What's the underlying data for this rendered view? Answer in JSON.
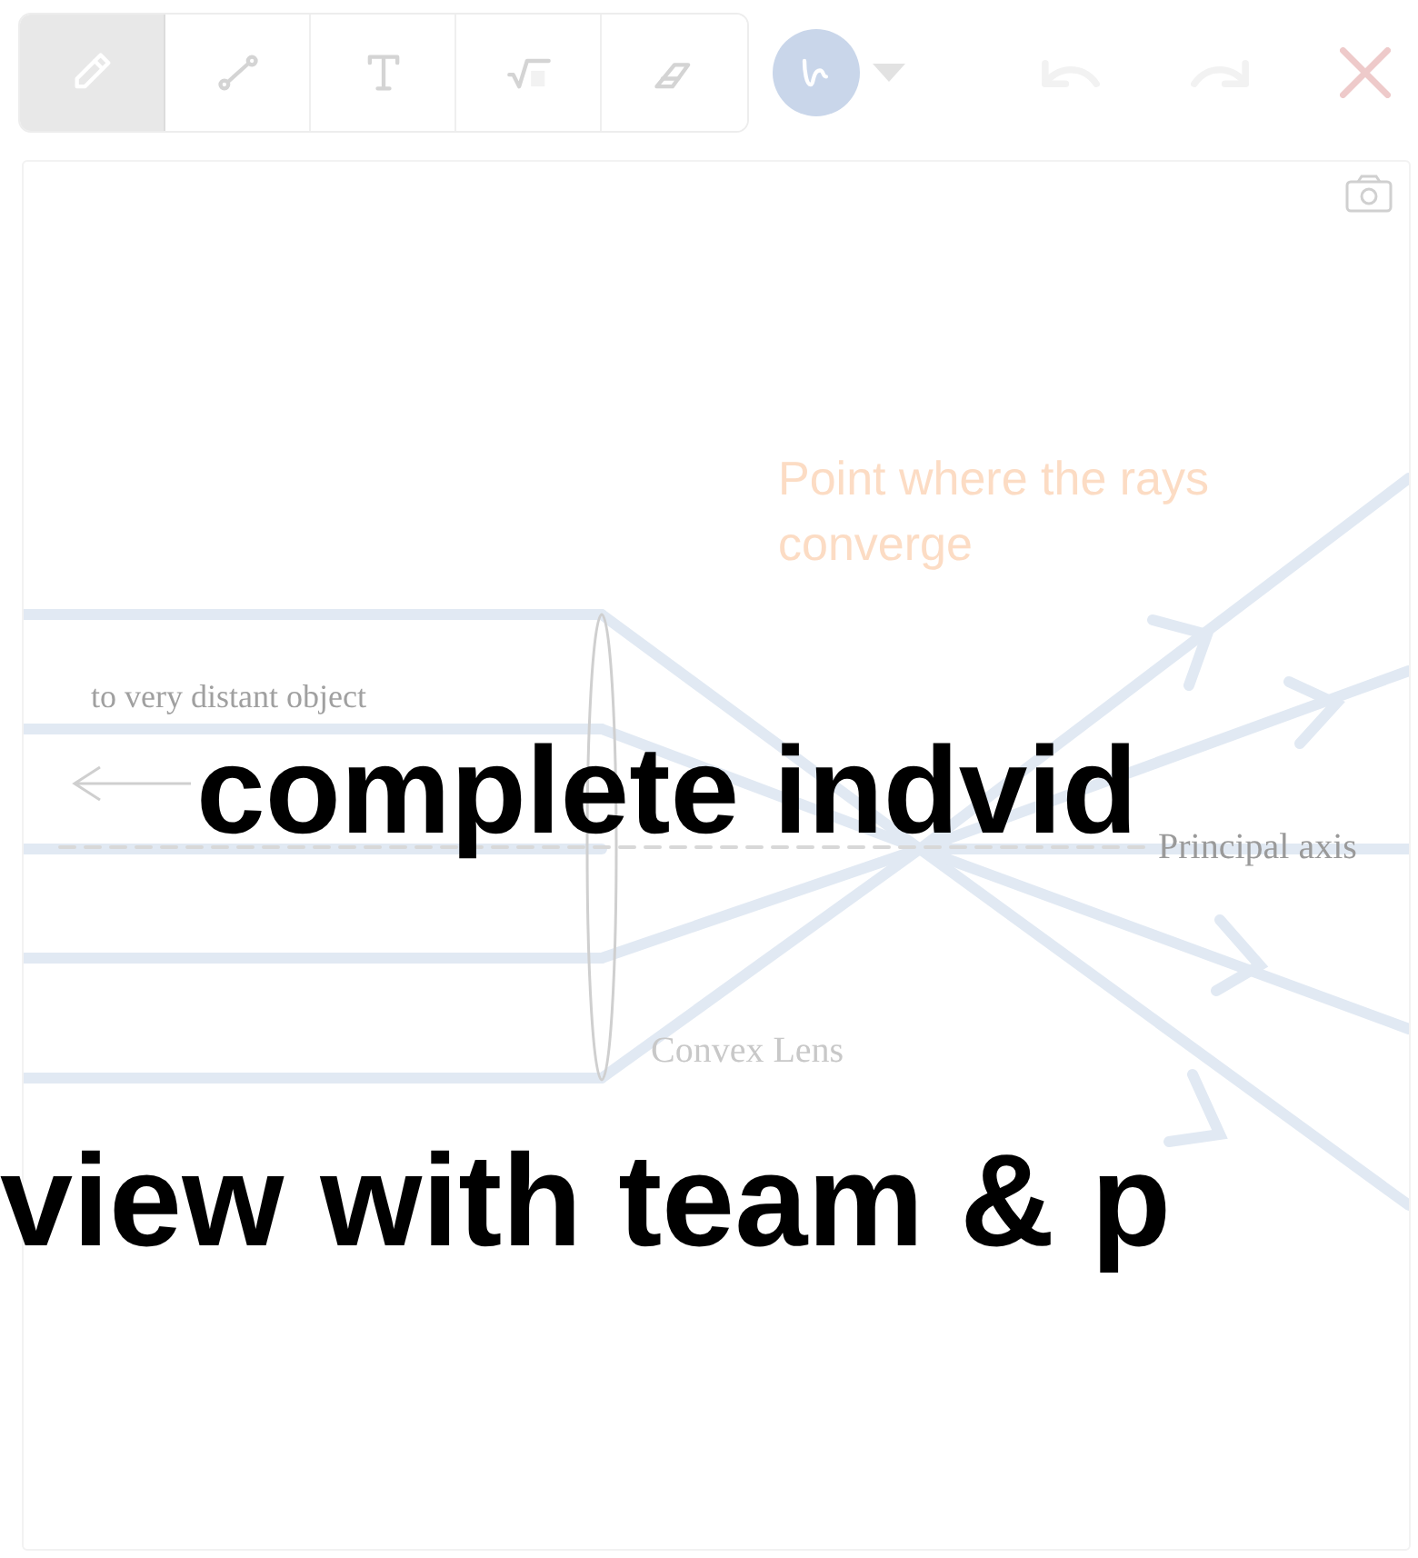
{
  "toolbar": {
    "tools": [
      {
        "kind": "pencil",
        "selected": true
      },
      {
        "kind": "line",
        "selected": false
      },
      {
        "kind": "text",
        "selected": false
      },
      {
        "kind": "math",
        "selected": false
      },
      {
        "kind": "eraser",
        "selected": false
      }
    ],
    "color_button": {
      "color": "#c9d6ea"
    },
    "actions": [
      {
        "kind": "undo",
        "disabled": true
      },
      {
        "kind": "redo",
        "disabled": true
      },
      {
        "kind": "close",
        "disabled": false
      }
    ]
  },
  "diagram": {
    "annotation": "Point where the rays converge",
    "left_label": "to very distant object",
    "axis_label": "Principal axis",
    "lens_label": "Convex Lens"
  },
  "overlay_lines": [
    "complete indvid",
    "view with team & p"
  ]
}
